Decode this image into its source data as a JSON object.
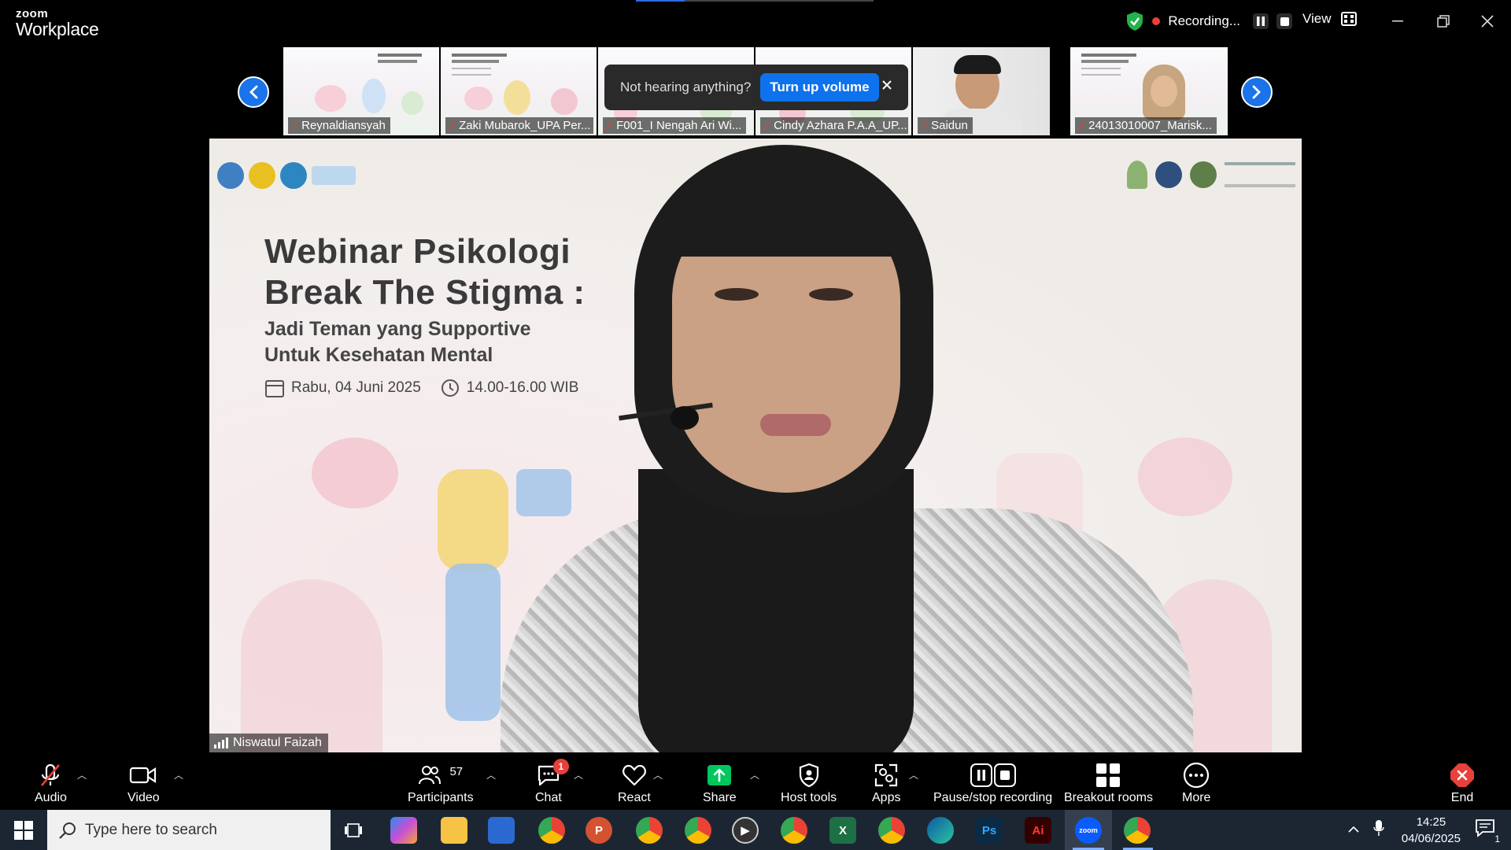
{
  "app": {
    "brand_small": "zoom",
    "brand_big": "Workplace"
  },
  "recording": {
    "label": "Recording..."
  },
  "view": {
    "label": "View"
  },
  "thumbnails": [
    {
      "name": "Reynaldiansyah"
    },
    {
      "name": "Zaki Mubarok_UPA Per..."
    },
    {
      "name": "F001_I Nengah Ari Wi..."
    },
    {
      "name": "Cindy Azhara P.A.A_UP..."
    },
    {
      "name": "Saidun"
    },
    {
      "name": "24013010007_Marisk..."
    }
  ],
  "popup": {
    "text": "Not hearing anything?",
    "button": "Turn up volume"
  },
  "slide": {
    "title_line1": "Webinar Psikologi",
    "title_line2": "Break The Stigma :",
    "subtitle_line1": "Jadi Teman yang Supportive",
    "subtitle_line2": "Untuk Kesehatan Mental",
    "date": "Rabu, 04 Juni 2025",
    "time": "14.00-16.00 WIB"
  },
  "speaker": {
    "name": "Niswatul Faizah"
  },
  "toolbar": {
    "audio": "Audio",
    "video": "Video",
    "participants": "Participants",
    "participants_count": "57",
    "chat": "Chat",
    "chat_badge": "1",
    "react": "React",
    "share": "Share",
    "host_tools": "Host tools",
    "apps": "Apps",
    "pause_stop": "Pause/stop recording",
    "breakout": "Breakout rooms",
    "more": "More",
    "end": "End"
  },
  "taskbar": {
    "search_placeholder": "Type here to search",
    "time": "14:25",
    "date": "04/06/2025",
    "notifications": "1"
  },
  "colors": {
    "accent": "#0e72ed",
    "record": "#e8403a",
    "share": "#00c65e",
    "taskbar": "#1c2633"
  }
}
